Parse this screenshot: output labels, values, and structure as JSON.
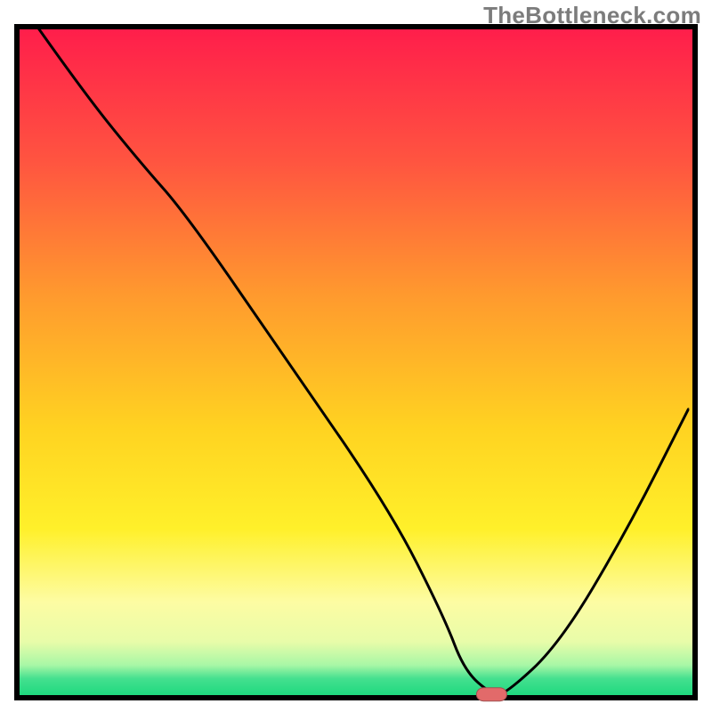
{
  "watermark": "TheBottleneck.com",
  "colors": {
    "border": "#000000",
    "curve": "#000000",
    "marker_fill": "#e26a6a",
    "marker_stroke": "#a05252",
    "gradient_stops": [
      {
        "offset": 0.0,
        "color": "#ff1e4b"
      },
      {
        "offset": 0.2,
        "color": "#ff5540"
      },
      {
        "offset": 0.4,
        "color": "#ff9a2e"
      },
      {
        "offset": 0.6,
        "color": "#ffd321"
      },
      {
        "offset": 0.75,
        "color": "#fff02a"
      },
      {
        "offset": 0.86,
        "color": "#fdfca3"
      },
      {
        "offset": 0.92,
        "color": "#e8fca9"
      },
      {
        "offset": 0.955,
        "color": "#a8f7a6"
      },
      {
        "offset": 0.975,
        "color": "#45e08f"
      },
      {
        "offset": 1.0,
        "color": "#1ed97f"
      }
    ]
  },
  "chart_data": {
    "type": "line",
    "title": "",
    "xlabel": "",
    "ylabel": "",
    "xlim": [
      0,
      100
    ],
    "ylim": [
      0,
      100
    ],
    "x": [
      3,
      10,
      18,
      25,
      40,
      55,
      63,
      66,
      70,
      72,
      80,
      90,
      99
    ],
    "values": [
      100,
      90,
      80,
      72,
      50,
      28,
      12,
      4,
      0.5,
      0.5,
      8,
      25,
      43
    ],
    "optimum_x": 70,
    "optimum_y": 0.5
  }
}
